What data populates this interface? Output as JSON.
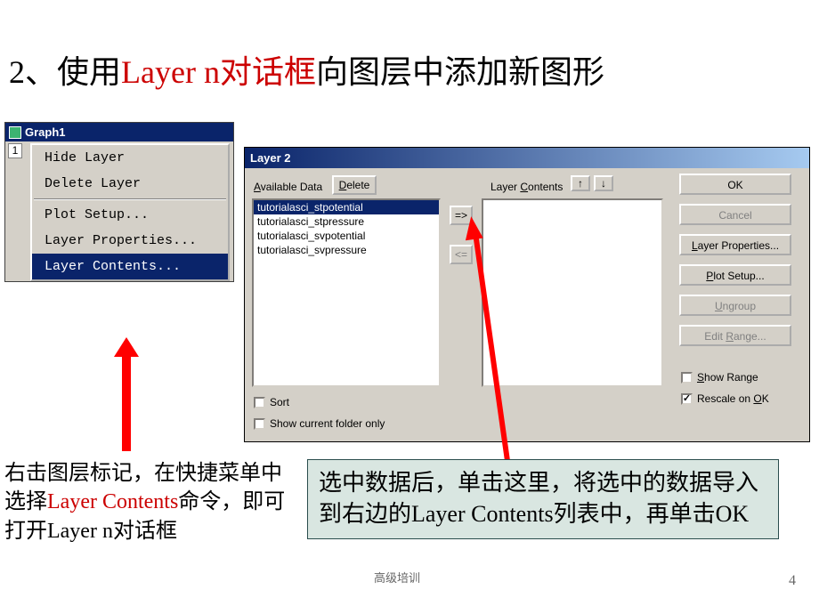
{
  "title": {
    "prefix": "2、使用",
    "red1": "Layer n",
    "red2": "对话框",
    "suffix": "向图层中添加新图形"
  },
  "graph_window": {
    "title": "Graph1",
    "layer_tab": "1",
    "menu": {
      "hide": "Hide Layer",
      "delete": "Delete Layer",
      "plot_setup": "Plot Setup...",
      "layer_props": "Layer Properties...",
      "layer_contents": "Layer Contents..."
    }
  },
  "dialog": {
    "title": "Layer 2",
    "available_label_pre": "A",
    "available_label_post": "vailable Data",
    "delete_btn_pre": "D",
    "delete_btn_post": "elete",
    "contents_label_pre": "Layer ",
    "contents_label_u": "C",
    "contents_label_post": "ontents",
    "list": {
      "i0": "tutorialasci_stpotential",
      "i1": "tutorialasci_stpressure",
      "i2": "tutorialasci_svpotential",
      "i3": "tutorialasci_svpressure"
    },
    "add_btn": "=>",
    "remove_btn": "<=",
    "up_btn": "↑",
    "down_btn": "↓",
    "sort_cb": "Sort",
    "folder_cb": "Show current folder only",
    "buttons": {
      "ok": "OK",
      "cancel": "Cancel",
      "layer_props_pre": "L",
      "layer_props_post": "ayer Properties...",
      "plot_setup_pre": "P",
      "plot_setup_post": "lot Setup...",
      "ungroup_pre": "U",
      "ungroup_post": "ngroup",
      "edit_range_pre": "Edit ",
      "edit_range_u": "R",
      "edit_range_post": "ange..."
    },
    "show_range_pre": "S",
    "show_range_post": "how Range",
    "rescale_pre": "Rescale on ",
    "rescale_u": "O",
    "rescale_post": "K"
  },
  "caption_left": {
    "t1": "右击图层标记，在快捷菜单中选择",
    "red": "Layer Contents",
    "t2": "命令，即可打开Layer n对话框"
  },
  "caption_right": {
    "text": "选中数据后，单击这里，将选中的数据导入到右边的Layer Contents列表中，再单击OK"
  },
  "footer": "高级培训",
  "page": "4"
}
